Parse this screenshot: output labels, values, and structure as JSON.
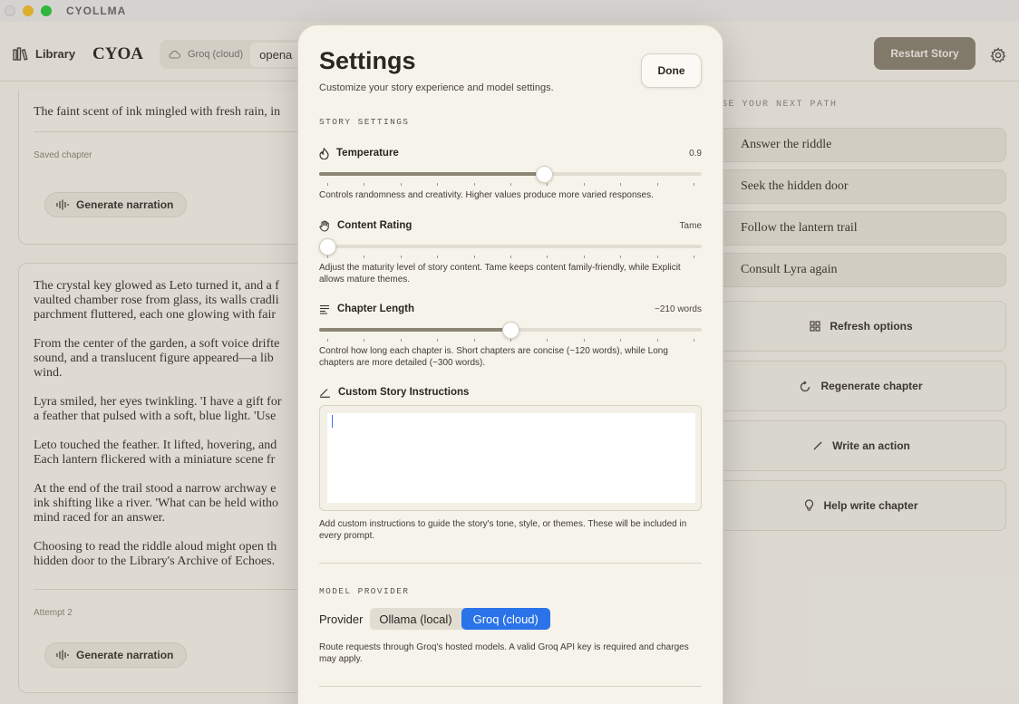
{
  "window": {
    "title": "CYOLLMA"
  },
  "toolbar": {
    "library_label": "Library",
    "brand": "CYOA",
    "provider_pill": "Groq (cloud)",
    "model_fragment": "opena",
    "restart_label": "Restart Story"
  },
  "story": {
    "card1_text": "The faint scent of ink mingled with fresh rain, in",
    "card1_meta": "Saved chapter",
    "narration_label": "Generate narration",
    "card2_paragraphs": [
      "The crystal key glowed as Leto turned it, and a f\nvaulted chamber rose from glass, its walls cradli\nparchment fluttered, each one glowing with fair",
      "From the center of the garden, a soft voice drifte\nsound, and a translucent figure appeared—a lib\nwind.",
      "Lyra smiled, her eyes twinkling. 'I have a gift for\na feather that pulsed with a soft, blue light. 'Use",
      "Leto touched the feather. It lifted, hovering, and\nEach lantern flickered with a miniature scene fr",
      "At the end of the trail stood a narrow archway e\nink shifting like a river. 'What can be held witho\nmind raced for an answer.",
      "Choosing to read the riddle aloud might open th\nhidden door to the Library's Archive of Echoes."
    ],
    "card2_meta": "Attempt 2"
  },
  "side": {
    "heading": "SE YOUR NEXT PATH",
    "choices": [
      "Answer the riddle",
      "Seek the hidden door",
      "Follow the lantern trail",
      "Consult Lyra again"
    ],
    "actions": [
      "Refresh options",
      "Regenerate chapter",
      "Write an action",
      "Help write chapter"
    ]
  },
  "settings": {
    "title": "Settings",
    "subtitle": "Customize your story experience and model settings.",
    "done_label": "Done",
    "story_section": "STORY SETTINGS",
    "temperature": {
      "label": "Temperature",
      "value": "0.9",
      "level": 0.594,
      "description": "Controls randomness and creativity. Higher values produce more varied responses."
    },
    "content_rating": {
      "label": "Content Rating",
      "value": "Tame",
      "level": 0.0,
      "description": "Adjust the maturity level of story content. Tame keeps content family-friendly, while Explicit allows mature themes."
    },
    "chapter_length": {
      "label": "Chapter Length",
      "value": "~210 words",
      "level": 0.5,
      "description": "Control how long each chapter is. Short chapters are concise (~120 words), while Long chapters are more detailed (~300 words)."
    },
    "custom_instructions": {
      "label": "Custom Story Instructions",
      "value": "",
      "description": "Add custom instructions to guide the story's tone, style, or themes. These will be included in every prompt."
    },
    "model_section": "MODEL PROVIDER",
    "provider_label": "Provider",
    "provider_options": [
      "Ollama (local)",
      "Groq (cloud)"
    ],
    "provider_selected": "Groq (cloud)",
    "provider_note": "Route requests through Groq's hosted models. A valid Groq API key is required and charges may apply."
  }
}
